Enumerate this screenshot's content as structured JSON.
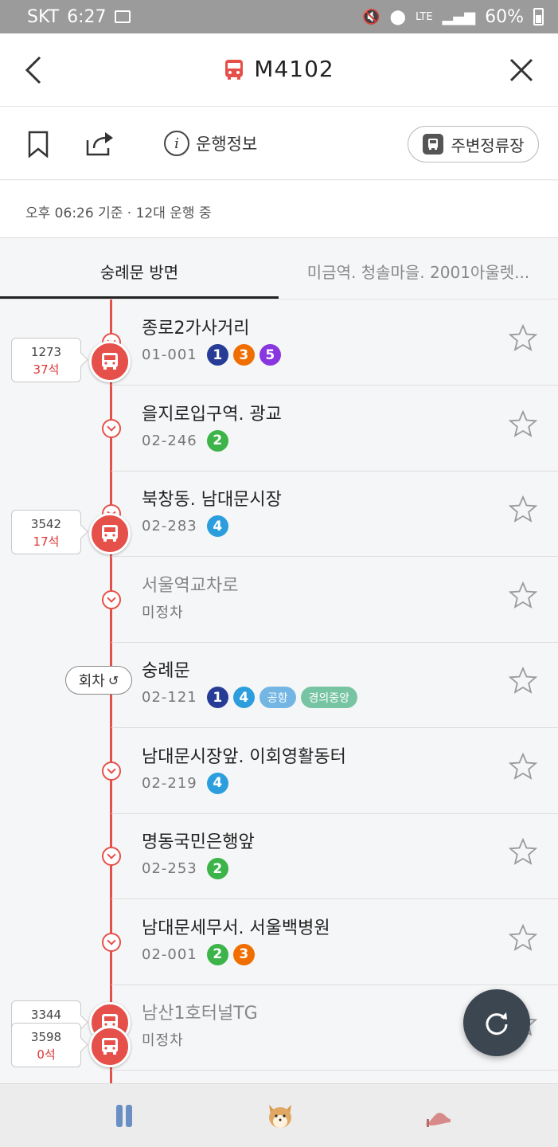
{
  "status_bar": {
    "carrier": "SKT",
    "time": "6:27",
    "network": "LTE",
    "battery": "60%"
  },
  "header": {
    "title": "M4102"
  },
  "toolbar": {
    "info_label": "운행정보",
    "nearby_label": "주변정류장"
  },
  "summary": {
    "text": "오후 06:26 기준 · 12대 운행 중"
  },
  "tabs": [
    {
      "label": "숭례문 방면",
      "active": true
    },
    {
      "label": "미금역. 청솔마을. 2001아울렛...",
      "active": false
    }
  ],
  "stops": [
    {
      "name": "종로2가사거리",
      "code": "01-001",
      "lines": [
        "1",
        "3",
        "5"
      ],
      "tags": [],
      "dim": false
    },
    {
      "name": "을지로입구역. 광교",
      "code": "02-246",
      "lines": [
        "2"
      ],
      "tags": [],
      "dim": false
    },
    {
      "name": "북창동. 남대문시장",
      "code": "02-283",
      "lines": [
        "4"
      ],
      "tags": [],
      "dim": false
    },
    {
      "name": "서울역교차로",
      "code": "미정차",
      "lines": [],
      "tags": [],
      "dim": true
    },
    {
      "name": "숭례문",
      "code": "02-121",
      "lines": [
        "1",
        "4"
      ],
      "tags": [
        "공항",
        "경의중앙"
      ],
      "dim": false
    },
    {
      "name": "남대문시장앞. 이회영활동터",
      "code": "02-219",
      "lines": [
        "4"
      ],
      "tags": [],
      "dim": false
    },
    {
      "name": "명동국민은행앞",
      "code": "02-253",
      "lines": [
        "2"
      ],
      "tags": [],
      "dim": false
    },
    {
      "name": "남대문세무서. 서울백병원",
      "code": "02-001",
      "lines": [
        "2",
        "3"
      ],
      "tags": [],
      "dim": false
    },
    {
      "name": "남산1호터널TG",
      "code": "미정차",
      "lines": [],
      "tags": [],
      "dim": true
    }
  ],
  "buses": [
    {
      "number": "1273",
      "seats": "37석"
    },
    {
      "number": "3542",
      "seats": "17석"
    },
    {
      "number": "3344",
      "seats": ""
    },
    {
      "number": "3598",
      "seats": "0석"
    }
  ],
  "turnaround": {
    "label": "회차"
  },
  "line_colors": {
    "1": "#263c96",
    "2": "#3cb44a",
    "3": "#f06e00",
    "4": "#2c9ede",
    "5": "#8936e0",
    "공항": "#73b6e4",
    "경의중앙": "#77c4a3"
  }
}
